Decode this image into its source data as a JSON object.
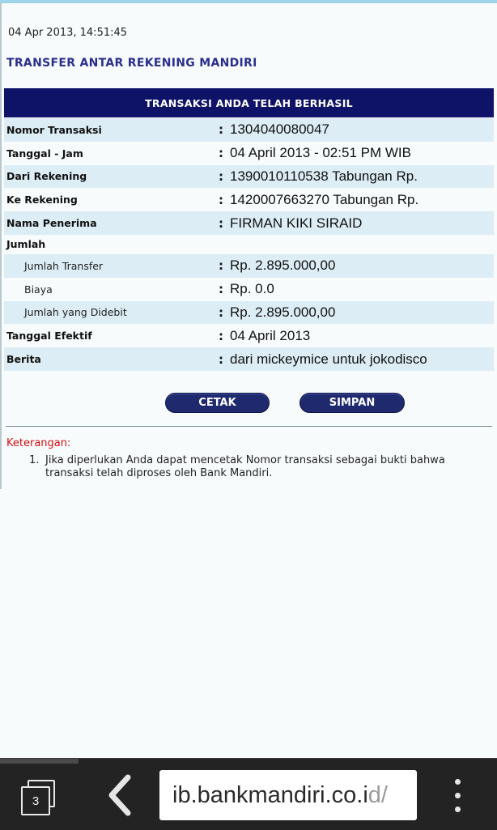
{
  "header": {
    "timestamp": "04 Apr 2013, 14:51:45",
    "title": "TRANSFER ANTAR REKENING MANDIRI"
  },
  "banner": "TRANSAKSI ANDA TELAH BERHASIL",
  "details": [
    {
      "label": "Nomor Transaksi",
      "value": "1304040080047"
    },
    {
      "label": "Tanggal - Jam",
      "value": "04 April 2013 - 02:51 PM WIB"
    },
    {
      "label": "Dari Rekening",
      "value": "1390010110538 Tabungan  Rp."
    },
    {
      "label": "Ke Rekening",
      "value": "1420007663270 Tabungan Rp."
    },
    {
      "label": "Nama Penerima",
      "value": "FIRMAN KIKI SIRAID"
    }
  ],
  "jumlah_label": "Jumlah",
  "amounts": [
    {
      "label": "Jumlah Transfer",
      "value": "Rp. 2.895.000,00"
    },
    {
      "label": "Biaya",
      "value": "Rp. 0.0"
    },
    {
      "label": "Jumlah yang Didebit",
      "value": "Rp. 2.895.000,00"
    }
  ],
  "extra": [
    {
      "label": "Tanggal Efektif",
      "value": "04 April 2013"
    },
    {
      "label": "Berita",
      "value": "dari mickeymice untuk jokodisco"
    }
  ],
  "colon": ":",
  "buttons": {
    "print": "CETAK",
    "save": "SIMPAN"
  },
  "notes": {
    "title": "Keterangan:",
    "items": [
      {
        "num": "1.",
        "text": "Jika diperlukan Anda dapat mencetak Nomor transaksi sebagai bukti bahwa transaksi telah diproses oleh Bank Mandiri."
      }
    ]
  },
  "browser": {
    "tab_count": "3",
    "url_main": "ib.bankmandiri.co.i",
    "url_faded": "d/",
    "icons": {
      "tabs": "tabs-icon",
      "back": "back-arrow-icon",
      "menu": "more-vert-icon"
    }
  },
  "colors": {
    "banner": "#0f1368",
    "title": "#2a2f8f",
    "row_shade": "#dcedf5",
    "note_title": "#d01010",
    "button": "#1f2a6e"
  }
}
